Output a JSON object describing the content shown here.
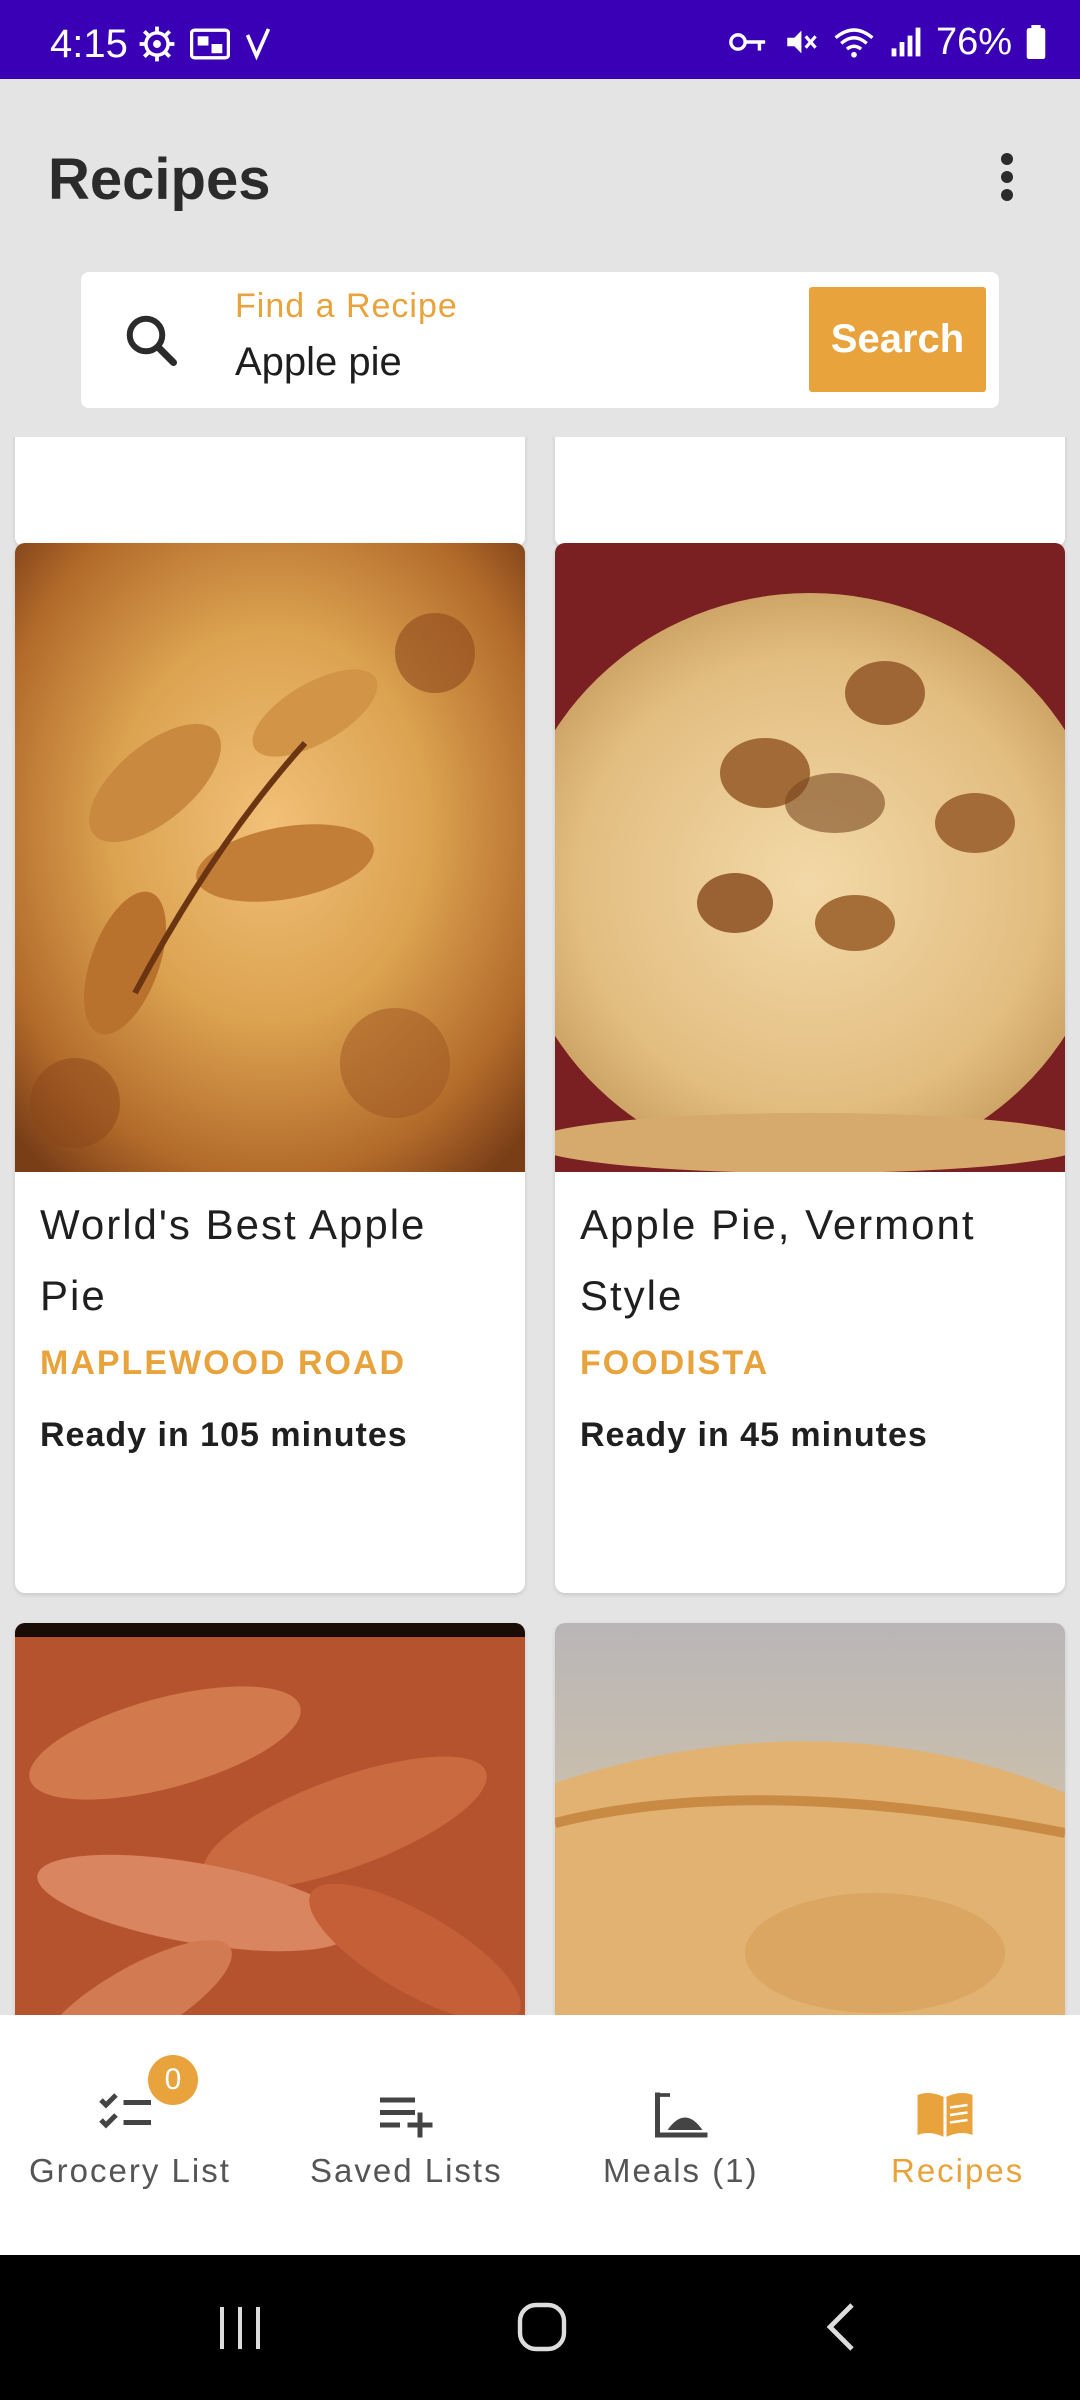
{
  "status_bar": {
    "time": "4:15",
    "battery": "76%",
    "left_icons": [
      "settings-icon",
      "sim-icon",
      "signal-check-icon"
    ],
    "right_icons": [
      "vpn-key-icon",
      "mute-icon",
      "wifi-icon",
      "cell-signal-icon",
      "battery-icon"
    ]
  },
  "app_bar": {
    "title": "Recipes"
  },
  "search": {
    "label": "Find a Recipe",
    "value": "Apple pie",
    "button_label": "Search"
  },
  "recipes": [
    {
      "title": "World's Best Apple Pie",
      "source": "MAPLEWOOD ROAD",
      "ready": "Ready in 105 minutes"
    },
    {
      "title": "Apple Pie, Vermont Style",
      "source": "FOODISTA",
      "ready": "Ready in 45 minutes"
    }
  ],
  "bottom_nav": {
    "items": [
      {
        "label": "Grocery List",
        "icon": "checklist-icon",
        "badge": "0"
      },
      {
        "label": "Saved Lists",
        "icon": "playlist-add-icon"
      },
      {
        "label": "Meals (1)",
        "icon": "meal-icon"
      },
      {
        "label": "Recipes",
        "icon": "book-icon",
        "active": true
      }
    ]
  },
  "colors": {
    "status_bar": "#3a00b5",
    "accent": "#e8a33c",
    "background": "#e4e4e4"
  }
}
